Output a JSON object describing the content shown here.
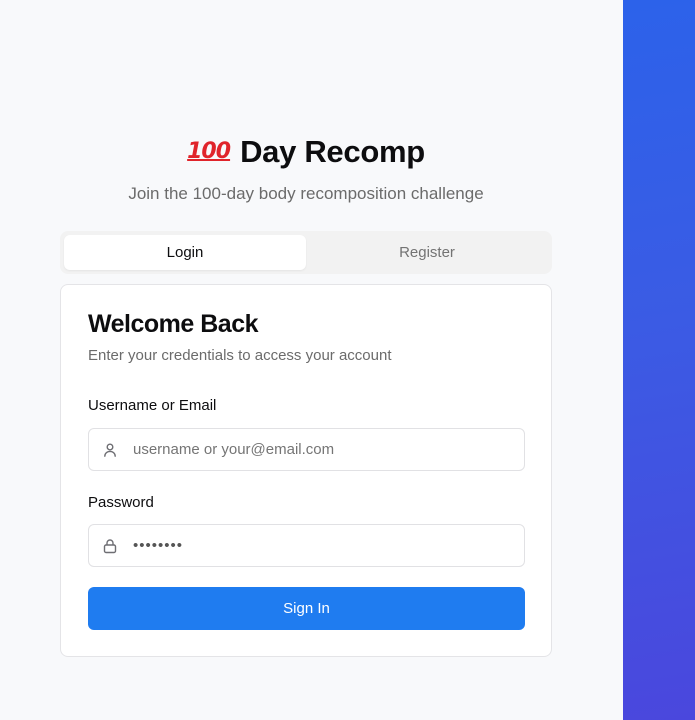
{
  "app": {
    "emoji_badge": "100",
    "title": "Day Recomp",
    "subtitle": "Join the 100-day body recomposition challenge"
  },
  "tabs": [
    {
      "label": "Login",
      "active": true
    },
    {
      "label": "Register",
      "active": false
    }
  ],
  "card": {
    "title": "Welcome Back",
    "description": "Enter your credentials to access your account"
  },
  "form": {
    "username": {
      "label": "Username or Email",
      "placeholder": "username or your@email.com",
      "value": "",
      "icon": "user-icon"
    },
    "password": {
      "label": "Password",
      "masked_value": "••••••••",
      "icon": "lock-icon"
    },
    "submit_label": "Sign In"
  },
  "colors": {
    "primary_button": "#1f7cf0",
    "side_panel_start": "#2c62ea",
    "side_panel_end": "#4a47dd",
    "emoji_red": "#e0242b"
  }
}
